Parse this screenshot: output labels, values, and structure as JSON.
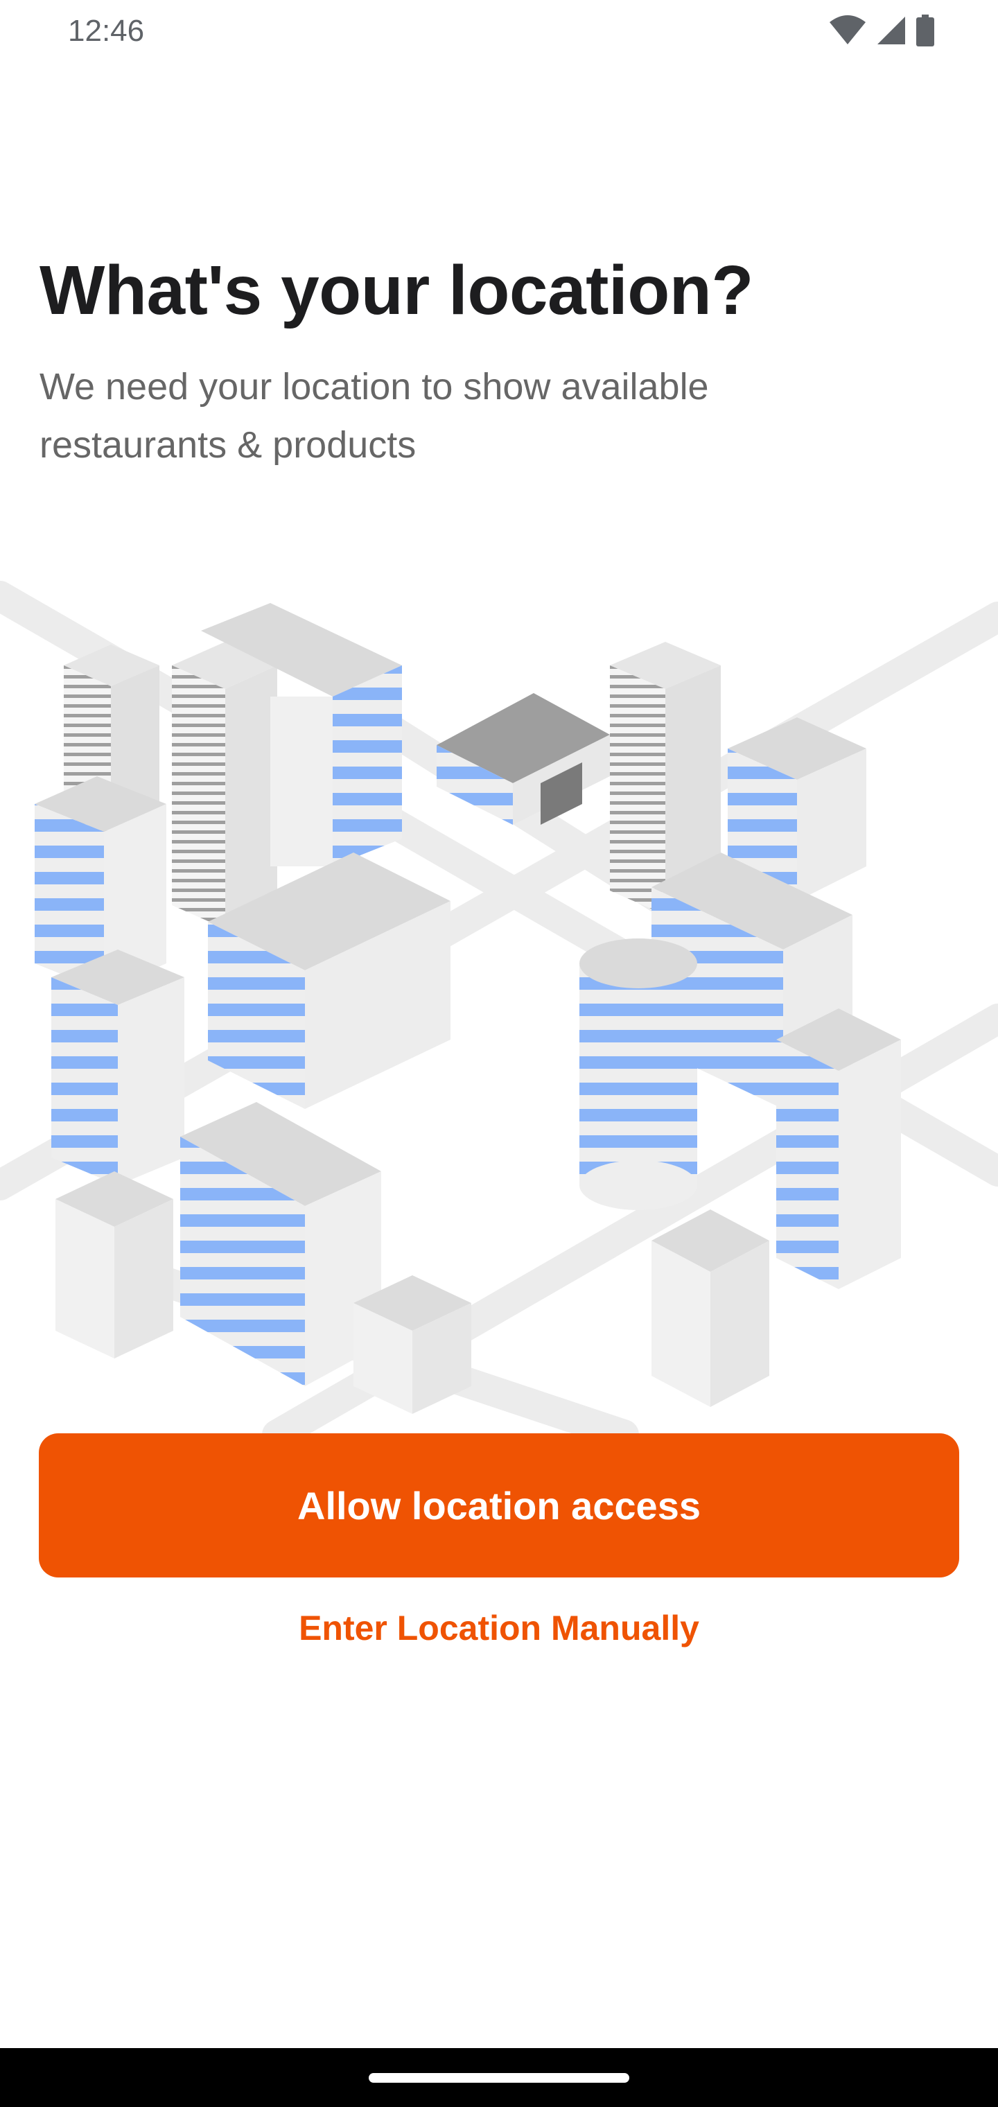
{
  "status_bar": {
    "time": "12:46",
    "icons": [
      "wifi-icon",
      "cellular-signal-icon",
      "battery-icon"
    ]
  },
  "title": "What's your location?",
  "subtitle": "We need your location to show available restaurants & products",
  "illustration": {
    "icon": "isometric-city-illustration",
    "colors": {
      "building_light": "#f0f0f0",
      "building_roof": "#d9d9d9",
      "window_blue": "#8ab4f8",
      "road": "#e8e8e8"
    }
  },
  "primary_button": {
    "label": "Allow location access"
  },
  "secondary_link": {
    "label": "Enter Location Manually"
  },
  "colors": {
    "accent": "#ef5303",
    "title": "#1d1d1f",
    "subtitle": "#666666"
  }
}
